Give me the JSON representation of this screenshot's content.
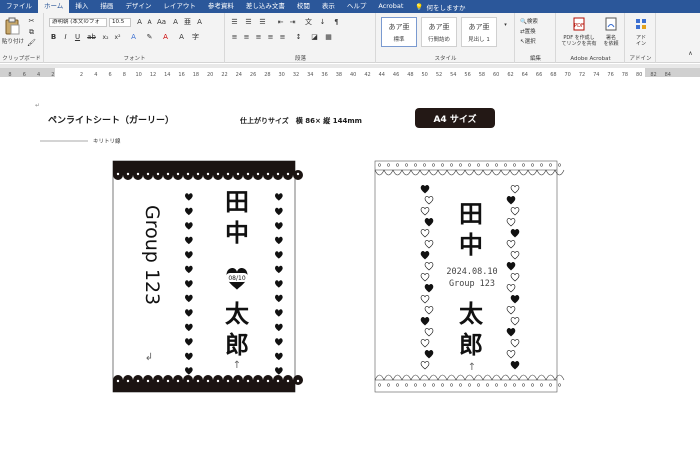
{
  "tabs": [
    "ファイル",
    "ホーム",
    "挿入",
    "描画",
    "デザイン",
    "レイアウト",
    "参考資料",
    "差し込み文書",
    "校閲",
    "表示",
    "ヘルプ",
    "Acrobat"
  ],
  "active_tab_index": 1,
  "tell_me": "何をしますか",
  "ribbon": {
    "paste_label": "貼り付け",
    "clipboard_label": "クリップボード",
    "font_name": "游明朝 (本文のフォ",
    "font_size": "10.5",
    "font_group_label": "フォント",
    "paragraph_group_label": "段落",
    "styles": [
      {
        "sample": "あア亜",
        "name": "標準"
      },
      {
        "sample": "あア亜",
        "name": "行間詰め"
      },
      {
        "sample": "あア亜",
        "name": "見出し 1"
      }
    ],
    "style_group_label": "スタイル",
    "edit_items": [
      "検索",
      "置換",
      "選択"
    ],
    "edit_group_label": "編集",
    "acrobat_label1": "PDF を作成し",
    "acrobat_label2": "てリンクを共有",
    "sign_label1": "署名",
    "sign_label2": "を依頼",
    "acrobat_group_label": "Adobe Acrobat",
    "addin_label1": "アド",
    "addin_label2": "イン",
    "addin_group_label": "アドイン"
  },
  "ruler_numbers": [
    "8",
    "6",
    "4",
    "2",
    "",
    "2",
    "4",
    "6",
    "8",
    "10",
    "12",
    "14",
    "16",
    "18",
    "20",
    "22",
    "24",
    "26",
    "28",
    "30",
    "32",
    "34",
    "36",
    "38",
    "40",
    "42",
    "44",
    "46",
    "48",
    "50",
    "52",
    "54",
    "56",
    "58",
    "60",
    "62",
    "64",
    "66",
    "68",
    "70",
    "72",
    "74",
    "76",
    "78",
    "80",
    "82",
    "84"
  ],
  "document": {
    "heading": "ペンライトシート（ガーリー）",
    "size_text": "仕上がりサイズ　横 86× 縦 144mm",
    "badge": "A4 サイズ",
    "cut_line_label": "キリトリ線",
    "sheet1": {
      "surname": "田中",
      "given_name": "太郎",
      "date": "08/10",
      "group": "Group 123"
    },
    "sheet2": {
      "surname": "田中",
      "given_name": "太郎",
      "date": "2024.08.10",
      "group": "Group 123"
    }
  },
  "colors": {
    "tab_bar": "#2b579a",
    "ribbon": "#f3f3f3",
    "badge": "#231815",
    "sheet1_bg": "#ffffff",
    "ink": "#111111"
  }
}
